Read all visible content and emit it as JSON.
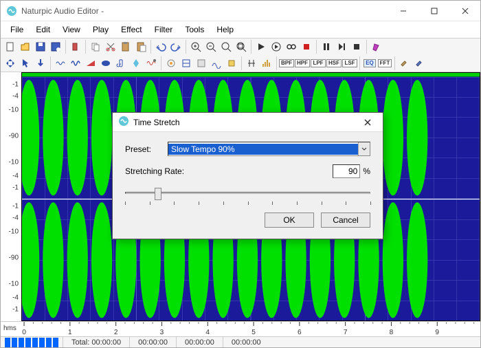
{
  "app": {
    "title": "Naturpic Audio Editor -"
  },
  "menu": [
    "File",
    "Edit",
    "View",
    "Play",
    "Effect",
    "Filter",
    "Tools",
    "Help"
  ],
  "filter_btns": [
    "BPF",
    "HPF",
    "LPF",
    "HSF",
    "LSF"
  ],
  "eq_btn": "EQ",
  "fft_btn": "FFT",
  "vscale": [
    "-1",
    "-4",
    "-10",
    "-90",
    "-10",
    "-4",
    "-1"
  ],
  "vscale2": [
    "-1",
    "-4",
    "-10",
    "-90",
    "-10",
    "-4",
    "-1"
  ],
  "timeline": {
    "hms": "hms",
    "ticks": [
      "0",
      "1",
      "2",
      "3",
      "4",
      "5",
      "6",
      "7",
      "8",
      "9"
    ]
  },
  "status": {
    "total_label": "Total: 00:00:00",
    "c1": "00:00:00",
    "c2": "00:00:00",
    "c3": "00:00:00"
  },
  "dialog": {
    "title": "Time Stretch",
    "preset_label": "Preset:",
    "preset_value": "Slow Tempo 90%",
    "rate_label": "Stretching Rate:",
    "rate_value": "90",
    "rate_unit": "%",
    "ok": "OK",
    "cancel": "Cancel",
    "slider_percent": 12
  }
}
